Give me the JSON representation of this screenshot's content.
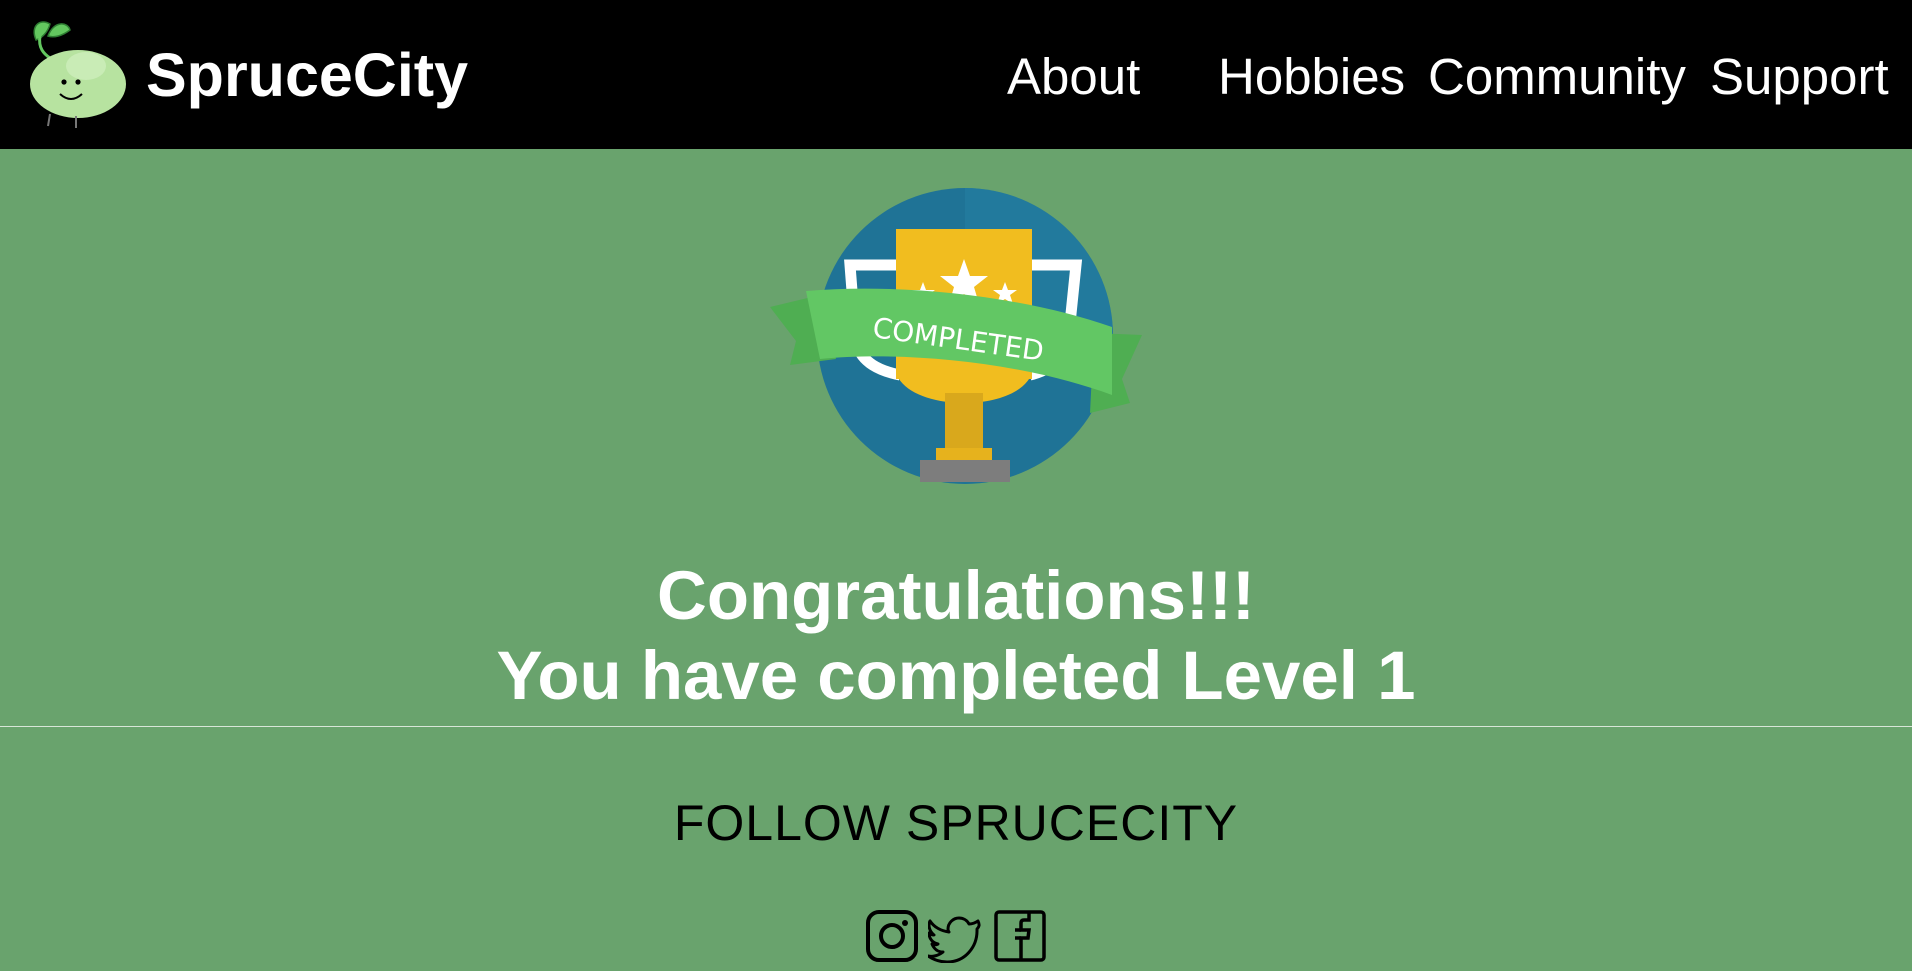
{
  "header": {
    "brand": "SpruceCity",
    "logo_icon": "bean-mascot-icon",
    "nav": [
      {
        "label": "About"
      },
      {
        "label": "Hobbies"
      },
      {
        "label": "Community"
      },
      {
        "label": "Support"
      }
    ]
  },
  "badge": {
    "icon": "trophy-completed-badge-icon",
    "ribbon_text": "COMPLETED"
  },
  "message": {
    "line1": "Congratulations!!!",
    "line2": "You have completed Level 1"
  },
  "footer": {
    "follow_text": "FOLLOW SPRUCECITY",
    "social": [
      {
        "icon": "instagram-icon"
      },
      {
        "icon": "twitter-icon"
      },
      {
        "icon": "facebook-icon"
      }
    ]
  },
  "colors": {
    "page_background": "#69a36d",
    "navbar": "#000000",
    "badge_circle": "#1f7396",
    "trophy": "#f1bd1f",
    "ribbon": "#62c764"
  }
}
